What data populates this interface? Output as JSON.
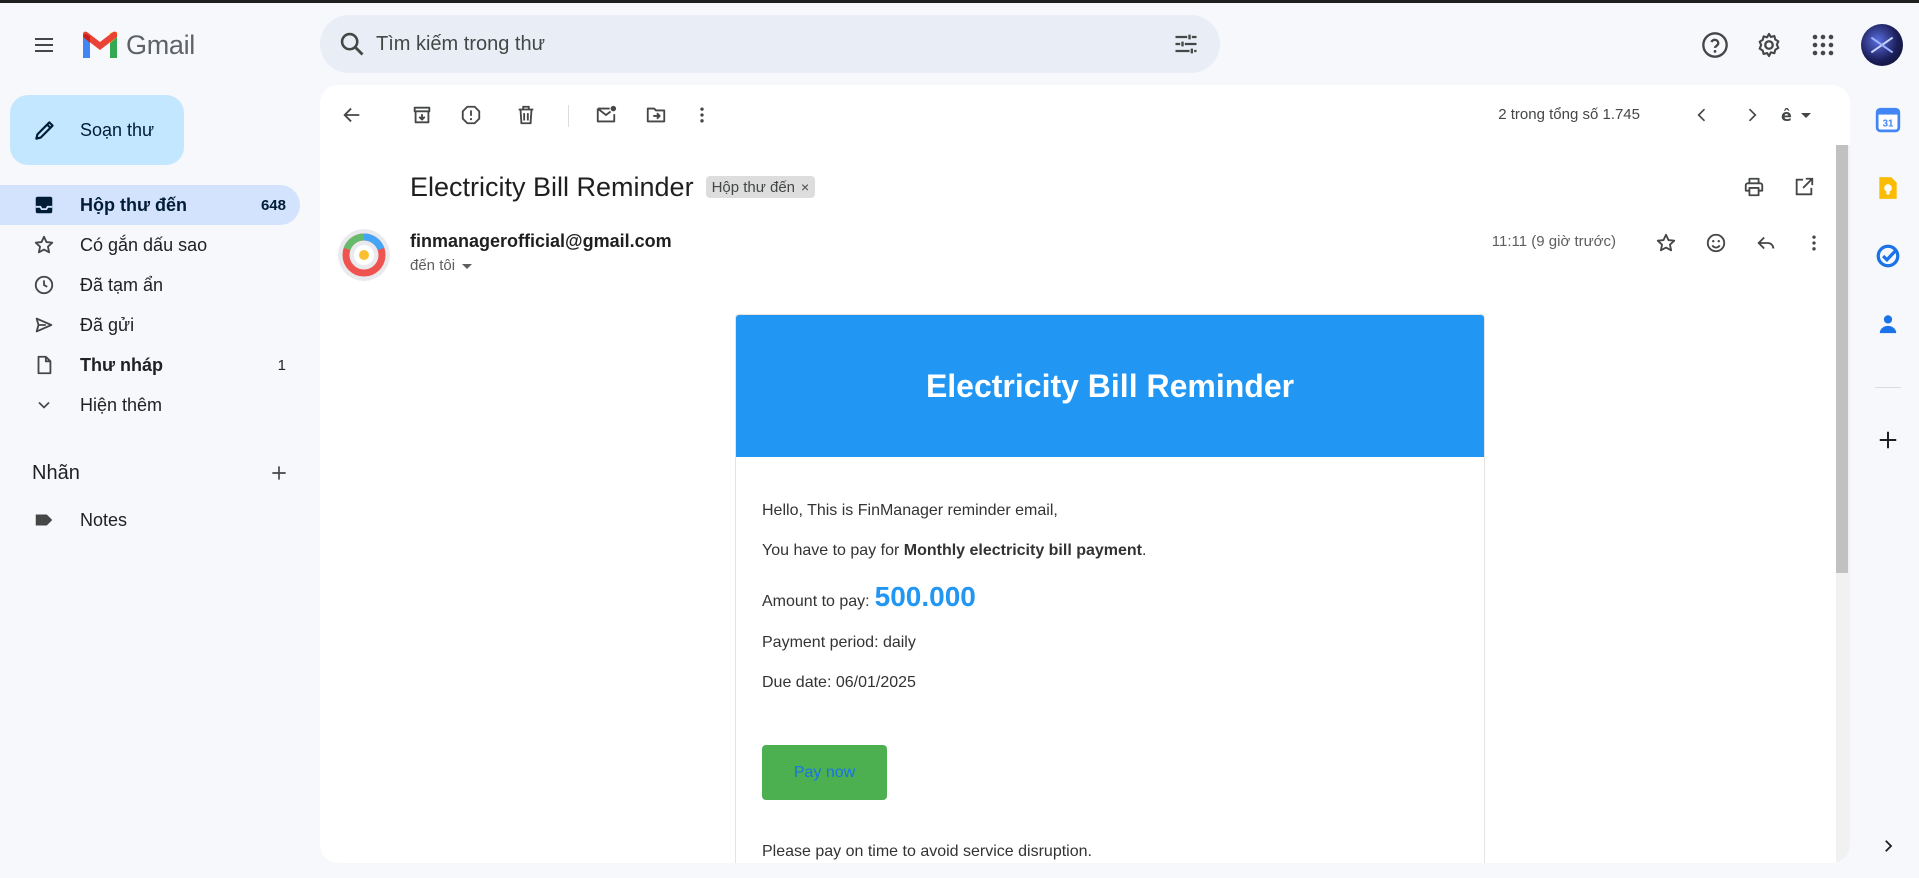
{
  "app": {
    "name": "Gmail"
  },
  "search": {
    "placeholder": "Tìm kiếm trong thư"
  },
  "compose": {
    "label": "Soạn thư"
  },
  "nav": {
    "items": [
      {
        "label": "Hộp thư đến",
        "count": "648"
      },
      {
        "label": "Có gắn dấu sao",
        "count": ""
      },
      {
        "label": "Đã tạm ẩn",
        "count": ""
      },
      {
        "label": "Đã gửi",
        "count": ""
      },
      {
        "label": "Thư nháp",
        "count": "1"
      },
      {
        "label": "Hiện thêm",
        "count": ""
      }
    ]
  },
  "labels": {
    "heading": "Nhãn",
    "items": [
      {
        "label": "Notes"
      }
    ]
  },
  "toolbar": {
    "pager": "2 trong tổng số 1.745"
  },
  "message": {
    "subject": "Electricity Bill Reminder",
    "tag": "Hộp thư đến",
    "tag_remove": "×",
    "sender": "finmanagerofficial@gmail.com",
    "to": "đến tôi",
    "time": "11:11 (9 giờ trước)"
  },
  "email": {
    "header": "Electricity Bill Reminder",
    "greeting": "Hello, This is FinManager reminder email,",
    "pay_prefix": "You have to pay for ",
    "pay_item": "Monthly electricity bill payment",
    "pay_suffix": ".",
    "amount_label": "Amount to pay:",
    "amount": "500.000",
    "period": "Payment period: daily",
    "due": "Due date: 06/01/2025",
    "button": "Pay now",
    "footer": "Please pay on time to avoid service disruption."
  },
  "colors": {
    "email_header": "#2196f3",
    "pay_button": "#4caf50",
    "active_nav": "#d3e3fd",
    "compose": "#c2e7ff"
  }
}
